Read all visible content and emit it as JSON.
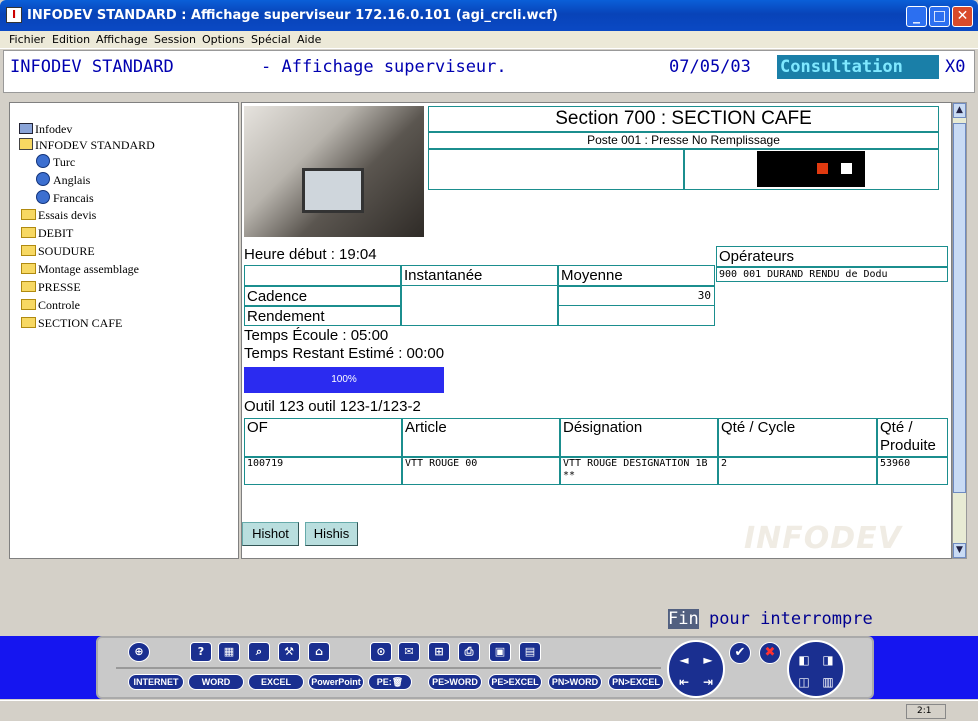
{
  "window": {
    "title": "INFODEV STANDARD : Affichage superviseur  172.16.0.101 (agi_crcli.wcf)",
    "app_icon": "I"
  },
  "menu": [
    "Fichier",
    "Edition",
    "Affichage",
    "Session",
    "Options",
    "Spécial",
    "Aide"
  ],
  "header": {
    "app_name": "INFODEV STANDARD",
    "subtitle": "- Affichage superviseur.",
    "date": "07/05/03",
    "mode": "Consultation",
    "code": "X0"
  },
  "tree": {
    "root": "Infodev",
    "standard": "INFODEV STANDARD",
    "languages": [
      "Turc",
      "Anglais",
      "Francais"
    ],
    "folders": [
      "Essais devis",
      "DEBIT",
      "SOUDURE",
      "Montage assemblage",
      "PRESSE",
      "Controle",
      "SECTION CAFE"
    ]
  },
  "section": {
    "title": "Section 700 : SECTION CAFE",
    "poste": "Poste 001 : Presse No Remplissage"
  },
  "indicator": {
    "colors": [
      "#000000",
      "#e03a10",
      "#ffffff"
    ]
  },
  "start_time": "Heure début : 19:04",
  "stats": {
    "col_instant": "Instantanée",
    "col_moyenne": "Moyenne",
    "row_cadence": "Cadence",
    "row_rendement": "Rendement",
    "cadence_moyenne": "30"
  },
  "operateurs": {
    "title": "Opérateurs",
    "rows": [
      "900 001    DURAND RENDU de Dodu"
    ]
  },
  "elapsed": "Temps Écoule : 05:00",
  "remaining": "Temps Restant Estimé : 00:00",
  "progress": {
    "label": "100%",
    "value": 1.0
  },
  "outil": "Outil 123 outil 123-1/123-2",
  "of_table": {
    "headers": [
      "OF",
      "Article",
      "Désignation",
      "Qté / Cycle",
      "Qté / Produite"
    ],
    "rows": [
      [
        "100719",
        "VTT ROUGE 00",
        "VTT ROUGE DESIGNATION 1B **",
        "2",
        "53960"
      ]
    ]
  },
  "buttons": {
    "hishot": "Hishot",
    "hishis": "Hishis"
  },
  "logo": "INFODEV",
  "status": {
    "fin_key": "Fin",
    "fin_text": " pour interrompre"
  },
  "toolbar": {
    "icons": [
      "target-icon",
      "help-icon",
      "calculator-icon",
      "search-icon",
      "tools-icon",
      "home-icon",
      "zoom-doc-icon",
      "mail-icon",
      "network-icon",
      "print-icon",
      "save-icon",
      "grid-icon"
    ],
    "text_buttons": [
      "INTERNET",
      "WORD",
      "EXCEL",
      "PowerPoint",
      "PE:",
      "PE>WORD",
      "PE>EXCEL",
      "PN>WORD",
      "PN>EXCEL"
    ]
  },
  "zoom": "2:1"
}
